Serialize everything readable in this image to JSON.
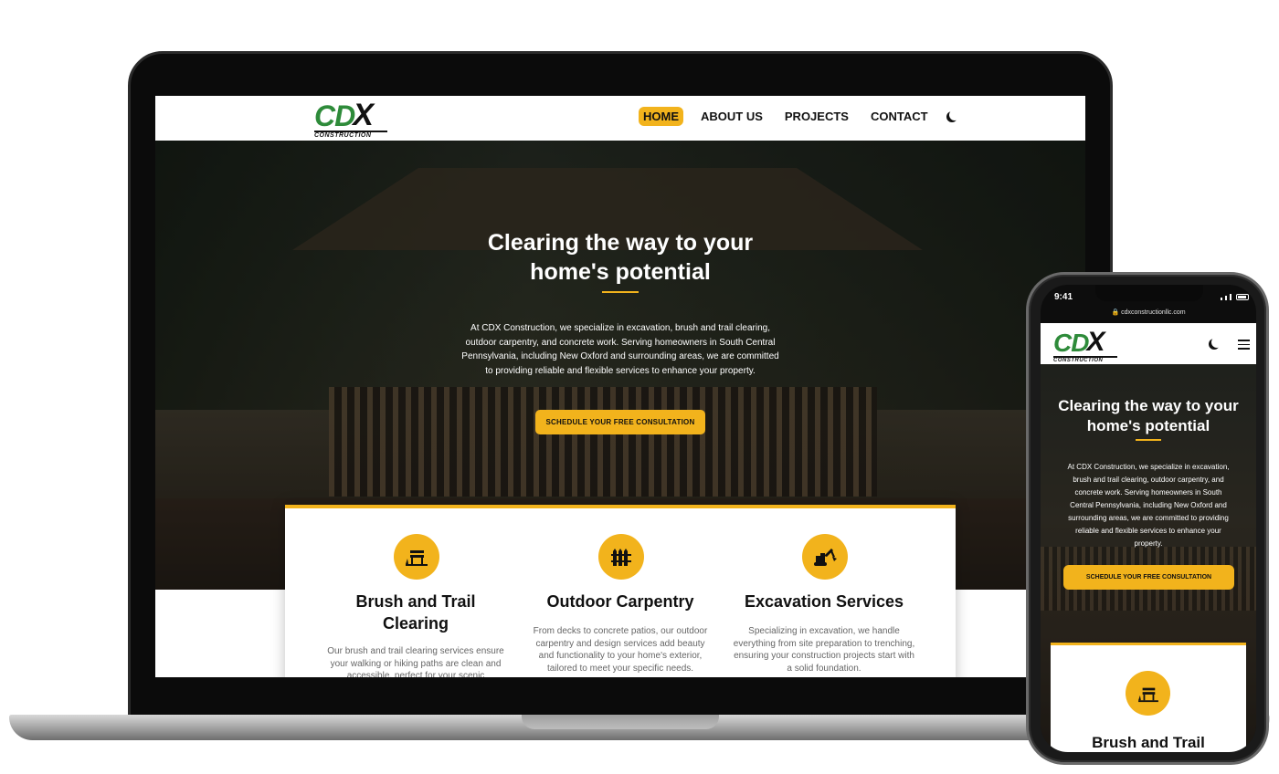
{
  "brand": {
    "logo_main": "CD",
    "logo_x": "X",
    "logo_sub": "CONSTRUCTION"
  },
  "nav": {
    "items": [
      {
        "label": "HOME",
        "active": true
      },
      {
        "label": "ABOUT US",
        "active": false
      },
      {
        "label": "PROJECTS",
        "active": false
      },
      {
        "label": "CONTACT",
        "active": false
      }
    ],
    "theme_toggle_icon": "moon-icon"
  },
  "hero": {
    "title_line1": "Clearing the way to your",
    "title_line2": "home's potential",
    "text": "At CDX Construction, we specialize in excavation, brush and trail clearing, outdoor carpentry, and concrete work. Serving homeowners in South Central Pennsylvania, including New Oxford and surrounding areas, we are committed to providing reliable and flexible services to enhance your property.",
    "cta_label": "SCHEDULE YOUR FREE CONSULTATION"
  },
  "services": [
    {
      "icon": "bench-icon",
      "title_line1": "Brush and Trail",
      "title_line2": "Clearing",
      "text": "Our brush and trail clearing services ensure your walking or hiking paths are clean and accessible, perfect for your scenic"
    },
    {
      "icon": "fence-icon",
      "title_line1": "Outdoor Carpentry",
      "title_line2": "",
      "text": "From decks to concrete patios, our outdoor carpentry and design services add beauty and functionality to your home's exterior, tailored to meet your specific needs."
    },
    {
      "icon": "excavator-icon",
      "title_line1": "Excavation Services",
      "title_line2": "",
      "text": "Specializing in excavation, we handle everything from site preparation to trenching, ensuring your construction projects start with a solid foundation."
    }
  ],
  "phone": {
    "time": "9:41",
    "url": "cdxconstructionllc.com",
    "hero_title_line1": "Clearing the way to your",
    "hero_title_line2": "home's potential",
    "hero_text": "At CDX Construction, we specialize in excavation, brush and trail clearing, outdoor carpentry, and concrete work. Serving homeowners in South Central Pennsylvania, including New Oxford and surrounding areas, we are committed to providing reliable and flexible services to enhance your property.",
    "cta_label": "SCHEDULE YOUR FREE CONSULTATION",
    "card_title": "Brush and Trail",
    "menu_icon": "hamburger-menu-icon"
  },
  "colors": {
    "accent": "#f2b31c",
    "logo_green": "#2e8b3a",
    "text_dark": "#111111",
    "text_muted": "#666666"
  }
}
